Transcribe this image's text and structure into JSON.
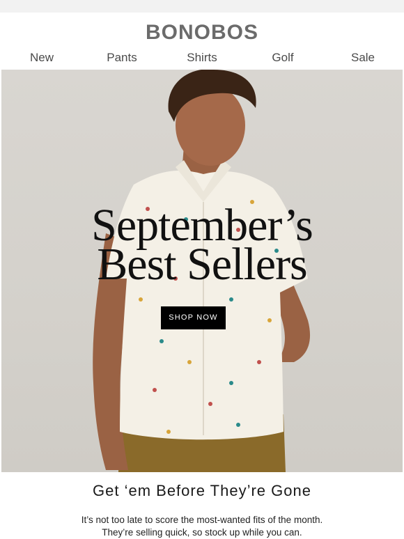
{
  "brand": {
    "name": "BONOBOS"
  },
  "nav": {
    "items": [
      "New",
      "Pants",
      "Shirts",
      "Golf",
      "Sale"
    ]
  },
  "hero": {
    "headline_line1": "September’s",
    "headline_line2": "Best Sellers",
    "cta_label": "SHOP NOW",
    "image": "man-in-printed-short-sleeve-shirt"
  },
  "content": {
    "subhead": "Get ‘em Before They’re Gone",
    "body_line1": "It’s not too late to score the most-wanted fits of the month.",
    "body_line2": "They’re selling quick, so stock up while you can."
  },
  "colors": {
    "brand_gray": "#6b6b6b",
    "cta_background": "#000000",
    "cta_text": "#ffffff",
    "hero_background": "#d6d3cd"
  }
}
